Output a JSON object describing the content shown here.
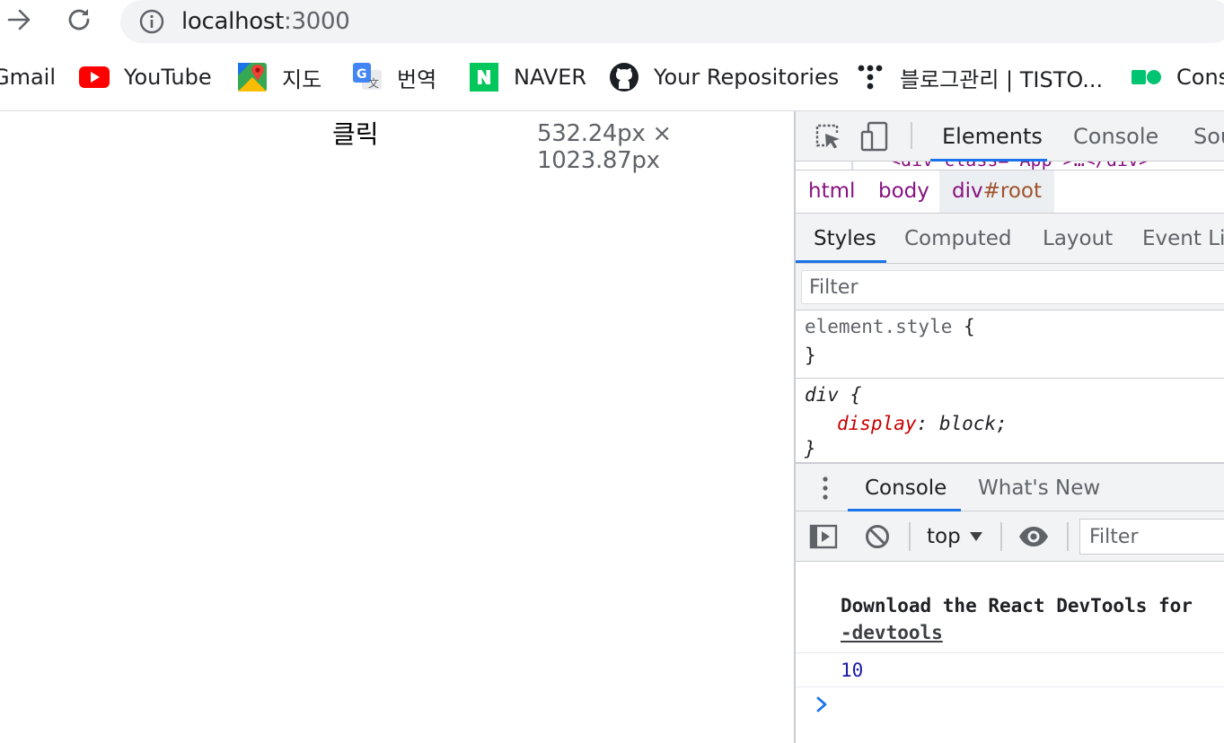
{
  "browser": {
    "url_host": "localhost",
    "url_port": ":3000"
  },
  "bookmarks": [
    {
      "label": "Gmail",
      "icon": "gmail-icon"
    },
    {
      "label": "YouTube",
      "icon": "youtube-icon"
    },
    {
      "label": "지도",
      "icon": "maps-icon"
    },
    {
      "label": "번역",
      "icon": "translate-icon"
    },
    {
      "label": "NAVER",
      "icon": "naver-icon"
    },
    {
      "label": "Your Repositories",
      "icon": "github-icon"
    },
    {
      "label": "블로그관리 | TISTO...",
      "icon": "tistory-icon"
    },
    {
      "label": "Cons",
      "icon": "cons-icon"
    }
  ],
  "page": {
    "click_label": "클릭",
    "dimension_tooltip": "532.24px × 1023.87px"
  },
  "devtools": {
    "tabs": [
      "Elements",
      "Console",
      "Sou"
    ],
    "active_tab": "Elements",
    "dom_fragment": "<div class=\"App\">…</div>",
    "breadcrumbs": {
      "html": "html",
      "body": "body",
      "root_tag": "div",
      "root_id": "#root"
    },
    "sub_tabs": [
      "Styles",
      "Computed",
      "Layout",
      "Event Lis"
    ],
    "styles_filter_placeholder": "Filter",
    "rules": {
      "element_selector": "element.style",
      "div_selector": "div",
      "div_property": "display",
      "div_value": "block"
    },
    "drawer_tabs": [
      "Console",
      "What's New"
    ],
    "console_toolbar": {
      "context": "top",
      "filter_placeholder": "Filter"
    },
    "console_messages": {
      "react_text": "Download the React DevTools for",
      "react_link": "-devtools",
      "number": "10"
    },
    "colors": {
      "accent": "#1a73e8",
      "tag": "#881280",
      "property": "#c80000",
      "number": "#1a1aa6"
    }
  }
}
